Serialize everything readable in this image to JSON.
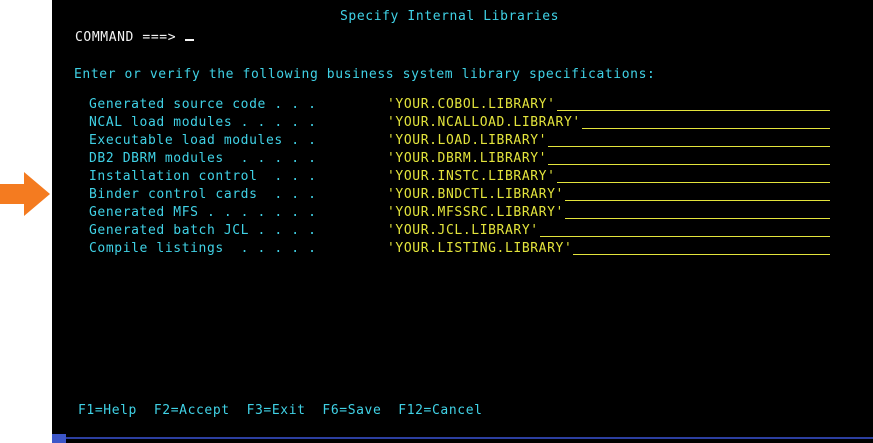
{
  "screen": {
    "title": "Specify Internal Libraries",
    "command_label": "COMMAND ===>",
    "command_value": "",
    "instruction": "Enter or verify the following business system library specifications:"
  },
  "fields": [
    {
      "label": "Generated source code . . .",
      "value": "'YOUR.COBOL.LIBRARY'"
    },
    {
      "label": "NCAL load modules . . . . .",
      "value": "'YOUR.NCALLOAD.LIBRARY'"
    },
    {
      "label": "Executable load modules . .",
      "value": "'YOUR.LOAD.LIBRARY'"
    },
    {
      "label": "DB2 DBRM modules  . . . . .",
      "value": "'YOUR.DBRM.LIBRARY'"
    },
    {
      "label": "Installation control  . . .",
      "value": "'YOUR.INSTC.LIBRARY'"
    },
    {
      "label": "Binder control cards  . . .",
      "value": "'YOUR.BNDCTL.LIBRARY'"
    },
    {
      "label": "Generated MFS . . . . . . .",
      "value": "'YOUR.MFSSRC.LIBRARY'"
    },
    {
      "label": "Generated batch JCL . . . .",
      "value": "'YOUR.JCL.LIBRARY'"
    },
    {
      "label": "Compile listings  . . . . .",
      "value": "'YOUR.LISTING.LIBRARY'"
    }
  ],
  "function_keys": [
    {
      "label": "F1=Help"
    },
    {
      "label": "F2=Accept"
    },
    {
      "label": "F3=Exit"
    },
    {
      "label": "F6=Save"
    },
    {
      "label": "F12=Cancel"
    }
  ],
  "colors": {
    "background": "#000000",
    "title": "#40d2e6",
    "label": "#40d2e6",
    "value": "#e3e43c",
    "command": "#f4f4f4",
    "arrow": "#f47b20"
  },
  "annotation": {
    "arrow_icon": "right-arrow-icon",
    "points_to_row": 6
  }
}
